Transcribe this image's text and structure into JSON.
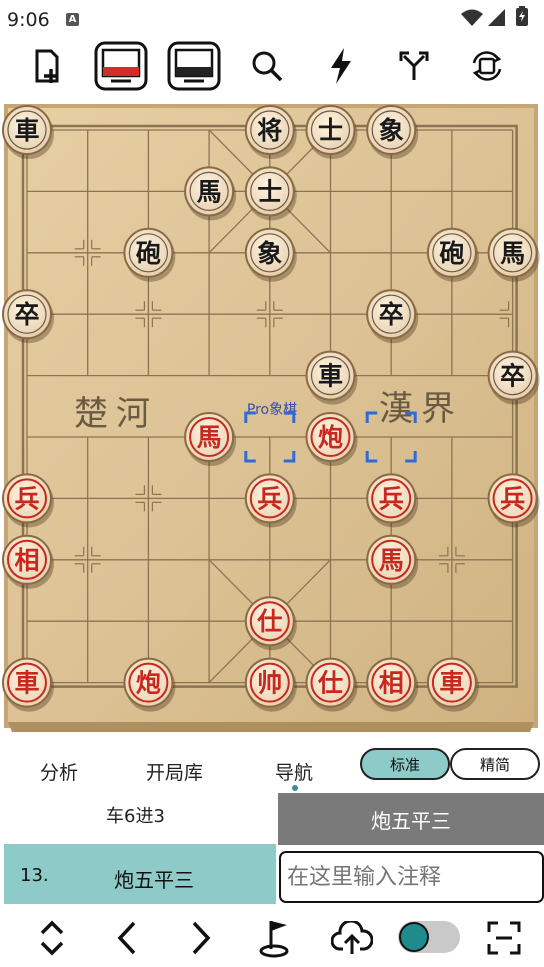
{
  "status": {
    "time": "9:06",
    "notify": "A"
  },
  "toolbar": {
    "buttons": [
      "new-game",
      "red-board-view",
      "black-board-view",
      "search",
      "flash",
      "branch",
      "rotate-board"
    ]
  },
  "board": {
    "river_left": "楚河",
    "river_right": "漢界",
    "watermark": "Pro象棋",
    "pieces": [
      {
        "ch": "車",
        "side": "black",
        "col": 0,
        "row": 0
      },
      {
        "ch": "将",
        "side": "black",
        "col": 4,
        "row": 0
      },
      {
        "ch": "士",
        "side": "black",
        "col": 5,
        "row": 0
      },
      {
        "ch": "象",
        "side": "black",
        "col": 6,
        "row": 0
      },
      {
        "ch": "馬",
        "side": "black",
        "col": 3,
        "row": 1
      },
      {
        "ch": "士",
        "side": "black",
        "col": 4,
        "row": 1
      },
      {
        "ch": "砲",
        "side": "black",
        "col": 2,
        "row": 2
      },
      {
        "ch": "象",
        "side": "black",
        "col": 4,
        "row": 2
      },
      {
        "ch": "砲",
        "side": "black",
        "col": 7,
        "row": 2
      },
      {
        "ch": "馬",
        "side": "black",
        "col": 8,
        "row": 2
      },
      {
        "ch": "卒",
        "side": "black",
        "col": 0,
        "row": 3
      },
      {
        "ch": "卒",
        "side": "black",
        "col": 6,
        "row": 3
      },
      {
        "ch": "車",
        "side": "black",
        "col": 5,
        "row": 4
      },
      {
        "ch": "卒",
        "side": "black",
        "col": 8,
        "row": 4
      },
      {
        "ch": "馬",
        "side": "red",
        "col": 3,
        "row": 5
      },
      {
        "ch": "炮",
        "side": "red",
        "col": 5,
        "row": 5
      },
      {
        "ch": "兵",
        "side": "red",
        "col": 0,
        "row": 6
      },
      {
        "ch": "兵",
        "side": "red",
        "col": 4,
        "row": 6
      },
      {
        "ch": "兵",
        "side": "red",
        "col": 6,
        "row": 6
      },
      {
        "ch": "兵",
        "side": "red",
        "col": 8,
        "row": 6
      },
      {
        "ch": "相",
        "side": "red",
        "col": 0,
        "row": 7
      },
      {
        "ch": "馬",
        "side": "red",
        "col": 6,
        "row": 7
      },
      {
        "ch": "仕",
        "side": "red",
        "col": 4,
        "row": 8
      },
      {
        "ch": "車",
        "side": "red",
        "col": 0,
        "row": 9
      },
      {
        "ch": "炮",
        "side": "red",
        "col": 2,
        "row": 9
      },
      {
        "ch": "帅",
        "side": "red",
        "col": 4,
        "row": 9
      },
      {
        "ch": "仕",
        "side": "red",
        "col": 5,
        "row": 9
      },
      {
        "ch": "相",
        "side": "red",
        "col": 6,
        "row": 9
      },
      {
        "ch": "車",
        "side": "red",
        "col": 7,
        "row": 9
      }
    ],
    "last_move": [
      {
        "col": 4,
        "row": 5
      },
      {
        "col": 6,
        "row": 5
      }
    ]
  },
  "tabs": {
    "analysis": "分析",
    "opening": "开局库",
    "navigate": "导航"
  },
  "mode": {
    "standard": "标准",
    "simple": "精简"
  },
  "moves": {
    "prev_black": "车6进3",
    "current_right": "炮五平三",
    "current_num": "13.",
    "current_red": "炮五平三",
    "comment_placeholder": "在这里输入注释"
  },
  "colors": {
    "accent": "#8ecbc8",
    "red_piece": "#c8281e",
    "black_piece": "#1a1a1a"
  }
}
